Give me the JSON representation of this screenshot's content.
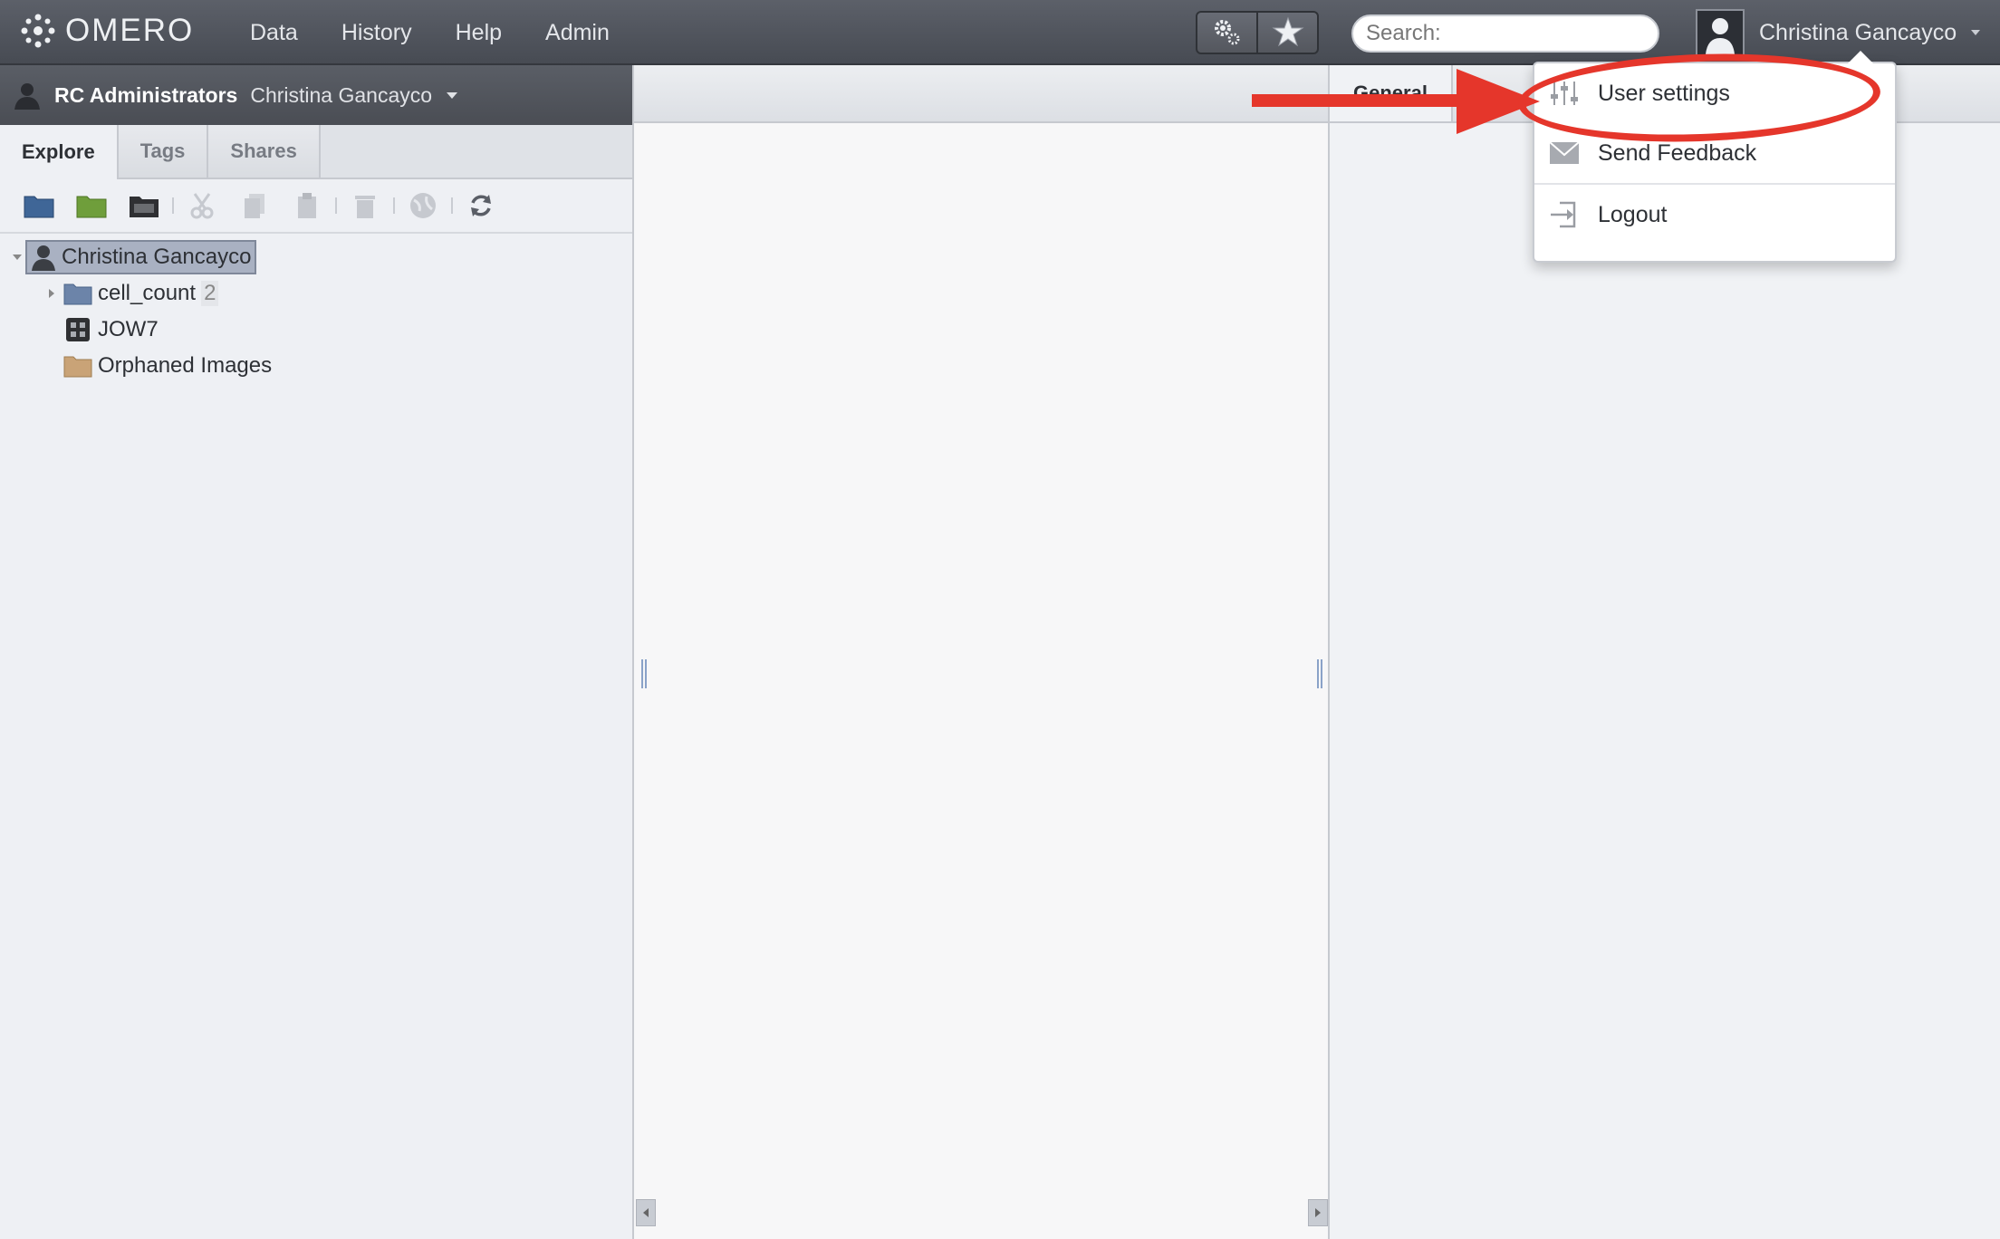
{
  "app": {
    "logo_text": "OMERO"
  },
  "nav": {
    "items": [
      "Data",
      "History",
      "Help",
      "Admin"
    ]
  },
  "search": {
    "placeholder": "Search:"
  },
  "user": {
    "name": "Christina Gancayco"
  },
  "group_bar": {
    "group": "RC Administrators",
    "user": "Christina Gancayco"
  },
  "tabs": [
    "Explore",
    "Tags",
    "Shares"
  ],
  "tree": {
    "root": "Christina Gancayco",
    "items": [
      {
        "label": "cell_count",
        "count": "2",
        "type": "project"
      },
      {
        "label": "JOW7",
        "type": "plate"
      },
      {
        "label": "Orphaned Images",
        "type": "orphaned"
      }
    ]
  },
  "right_panel": {
    "tab": "General"
  },
  "dropdown": {
    "items": [
      {
        "label": "User settings",
        "icon": "sliders-icon"
      },
      {
        "label": "Send Feedback",
        "icon": "envelope-icon"
      },
      {
        "label": "Logout",
        "icon": "logout-icon"
      }
    ]
  },
  "colors": {
    "annotation": "#e5362b",
    "topbar": "#4d5159",
    "selection": "#a9b1c2"
  }
}
